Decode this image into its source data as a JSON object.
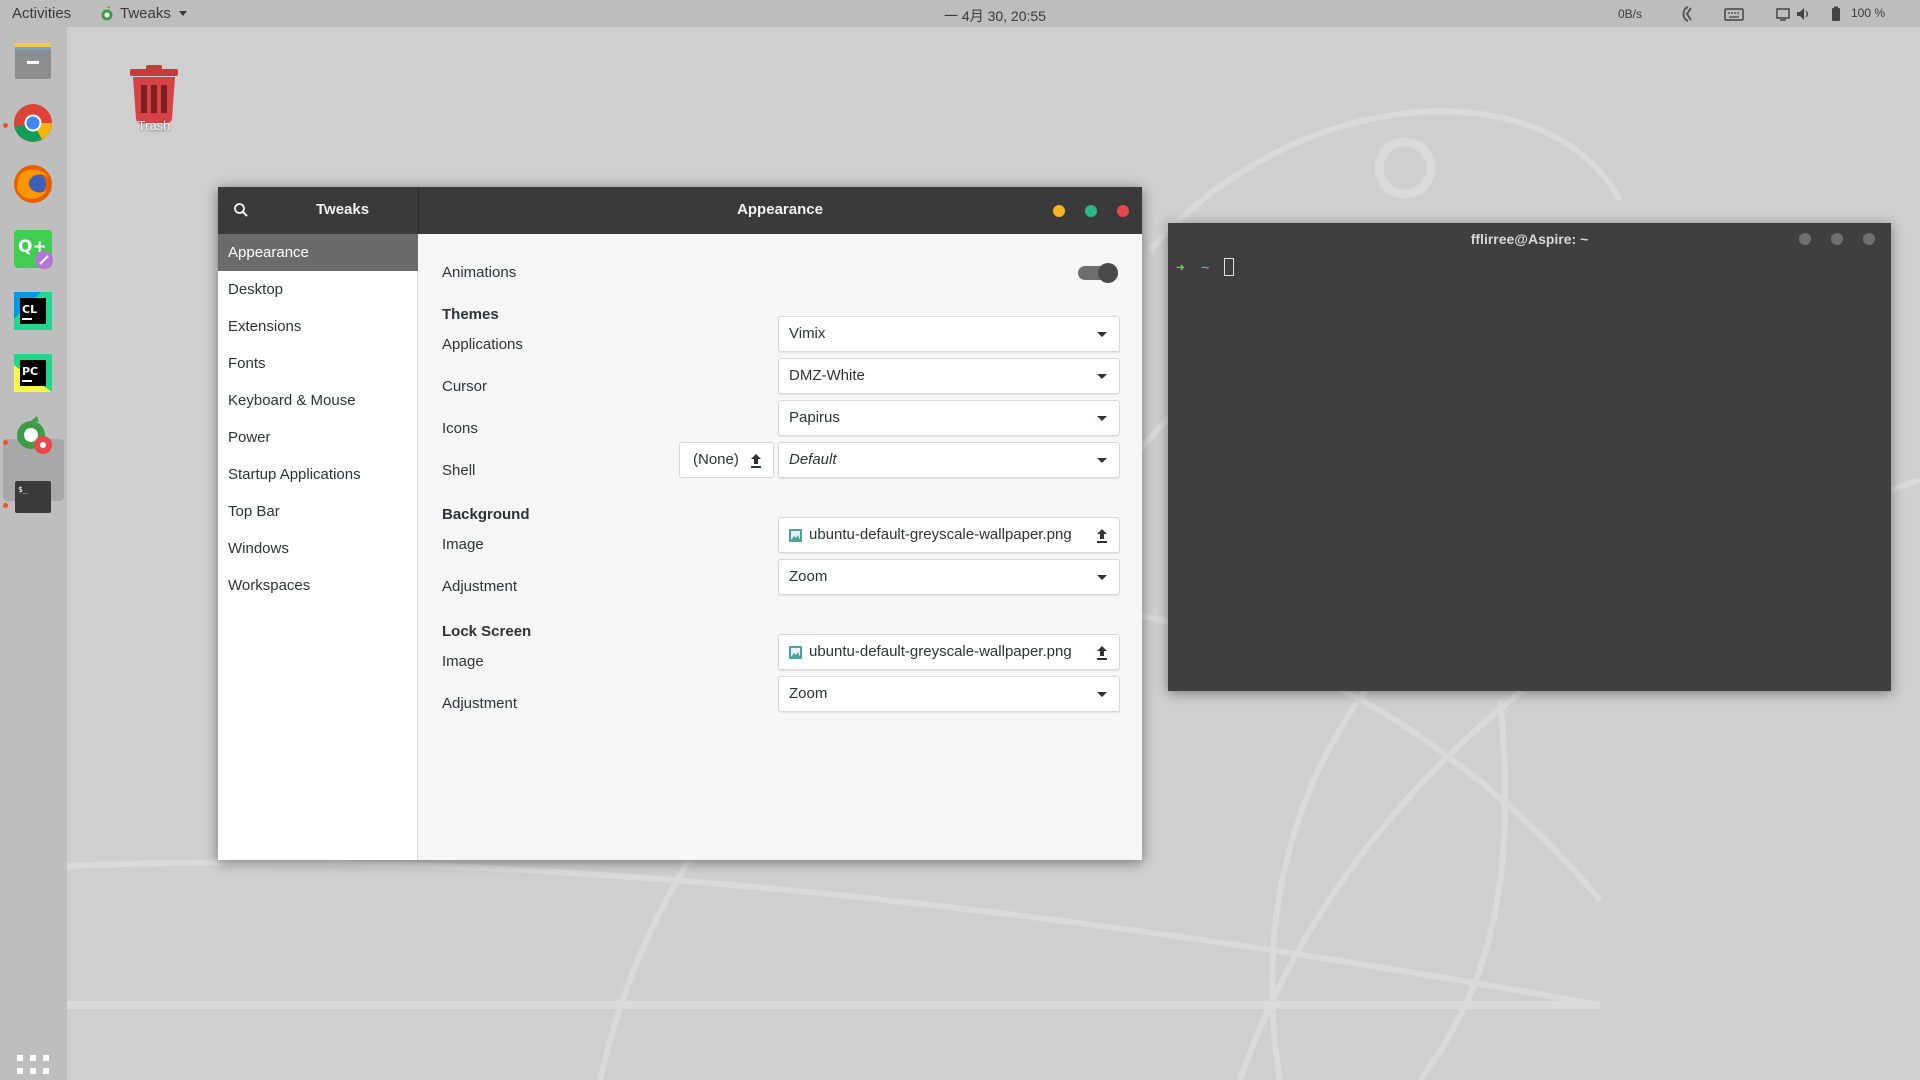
{
  "topbar": {
    "activities": "Activities",
    "app_name": "Tweaks",
    "clock": "一 4月 30, 20:55",
    "net_speed": "0B/s",
    "battery": "100 %"
  },
  "desktop": {
    "trash_label": "Trash"
  },
  "tweaks": {
    "title": "Tweaks",
    "page_title": "Appearance",
    "sidebar": [
      "Appearance",
      "Desktop",
      "Extensions",
      "Fonts",
      "Keyboard & Mouse",
      "Power",
      "Startup Applications",
      "Top Bar",
      "Windows",
      "Workspaces"
    ],
    "animations_label": "Animations",
    "animations_on": true,
    "themes_header": "Themes",
    "applications_label": "Applications",
    "applications_value": "Vimix",
    "cursor_label": "Cursor",
    "cursor_value": "DMZ-White",
    "icons_label": "Icons",
    "icons_value": "Papirus",
    "shell_label": "Shell",
    "shell_file": "(None)",
    "shell_value": "Default",
    "background_header": "Background",
    "bg_image_label": "Image",
    "bg_image_value": "ubuntu-default-greyscale-wallpaper.png",
    "bg_adjust_label": "Adjustment",
    "bg_adjust_value": "Zoom",
    "lock_header": "Lock Screen",
    "lock_image_label": "Image",
    "lock_image_value": "ubuntu-default-greyscale-wallpaper.png",
    "lock_adjust_label": "Adjustment",
    "lock_adjust_value": "Zoom"
  },
  "terminal": {
    "title": "fflirree@Aspire: ~",
    "prompt_arrow": "➜",
    "prompt_dir": "~"
  },
  "colors": {
    "minimize": "#f5b324",
    "maximize": "#2ab68b",
    "close": "#e8484c",
    "accent": "#e95420"
  }
}
